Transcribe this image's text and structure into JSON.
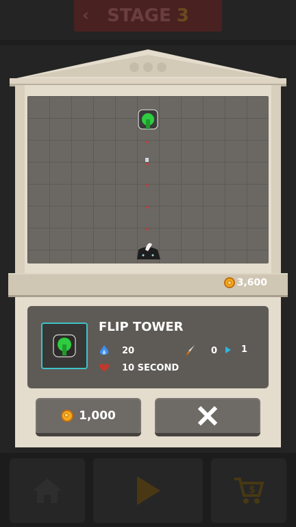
{
  "header": {
    "back_symbol": "‹",
    "stage_label": "STAGE",
    "stage_number": "3"
  },
  "gold": {
    "amount": "3,600"
  },
  "tower": {
    "name": "FLIP TOWER",
    "range": "20",
    "cooldown": "10 SECOND",
    "attack": "0",
    "speed": "1"
  },
  "buttons": {
    "buy_label": "1,000",
    "close_symbol": "✕"
  },
  "bottom_bar": {
    "home_icon": "home-icon",
    "play_icon": "play-icon",
    "shop_icon": "shop-cart-icon"
  },
  "colors": {
    "highlight": "#3fc3c9",
    "turret": "#2ecc40",
    "coin": "#f3a81f"
  }
}
